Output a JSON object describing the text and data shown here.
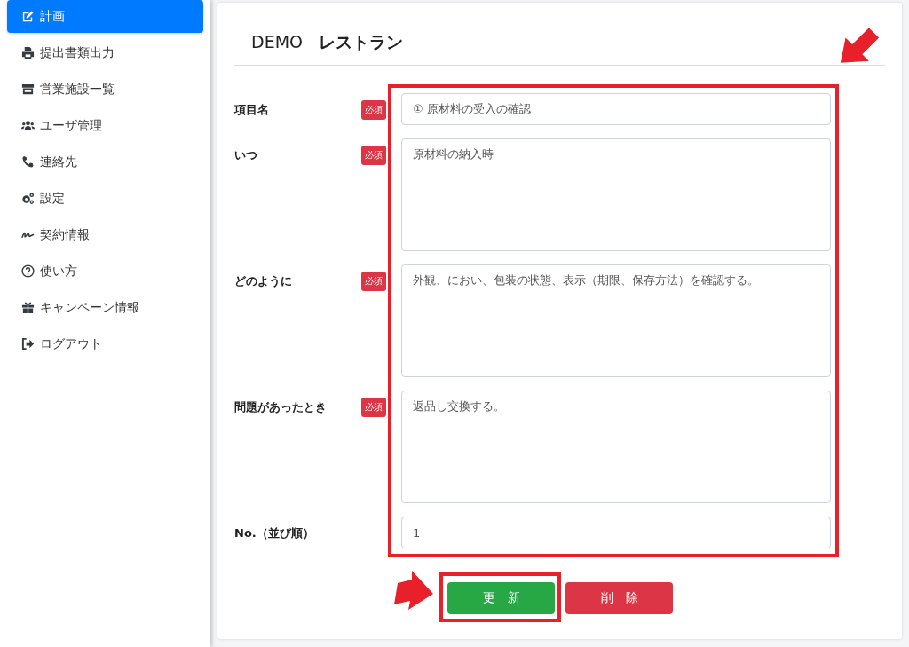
{
  "sidebar": {
    "items": [
      {
        "label": "計画",
        "kind": "edit",
        "selected": true
      },
      {
        "label": "提出書類出力",
        "kind": "print",
        "selected": false
      },
      {
        "label": "営業施設一覧",
        "kind": "store",
        "selected": false
      },
      {
        "label": "ユーザ管理",
        "kind": "users",
        "selected": false
      },
      {
        "label": "連絡先",
        "kind": "phone",
        "selected": false
      },
      {
        "label": "設定",
        "kind": "gears",
        "selected": false
      },
      {
        "label": "契約情報",
        "kind": "signature",
        "selected": false
      },
      {
        "label": "使い方",
        "kind": "question",
        "selected": false
      },
      {
        "label": "キャンペーン情報",
        "kind": "gift",
        "selected": false
      },
      {
        "label": "ログアウト",
        "kind": "logout",
        "selected": false
      }
    ]
  },
  "header": {
    "prefix": "DEMO",
    "title": "レストラン"
  },
  "form": {
    "fields": [
      {
        "label": "項目名",
        "badge": "必須",
        "kind": "input",
        "value": "① 原材料の受入の確認"
      },
      {
        "label": "いつ",
        "badge": "必須",
        "kind": "textarea",
        "value": "原材料の納入時"
      },
      {
        "label": "どのように",
        "badge": "必須",
        "kind": "textarea",
        "value": "外観、におい、包装の状態、表示（期限、保存方法）を確認する。"
      },
      {
        "label": "問題があったとき",
        "badge": "必須",
        "kind": "textarea",
        "value": "返品し交換する。"
      },
      {
        "label": "No.（並び順）",
        "kind": "input",
        "value": "1"
      }
    ]
  },
  "buttons": [
    {
      "label": "更　新",
      "kind": "update"
    },
    {
      "label": "削　除",
      "kind": "delete"
    }
  ]
}
